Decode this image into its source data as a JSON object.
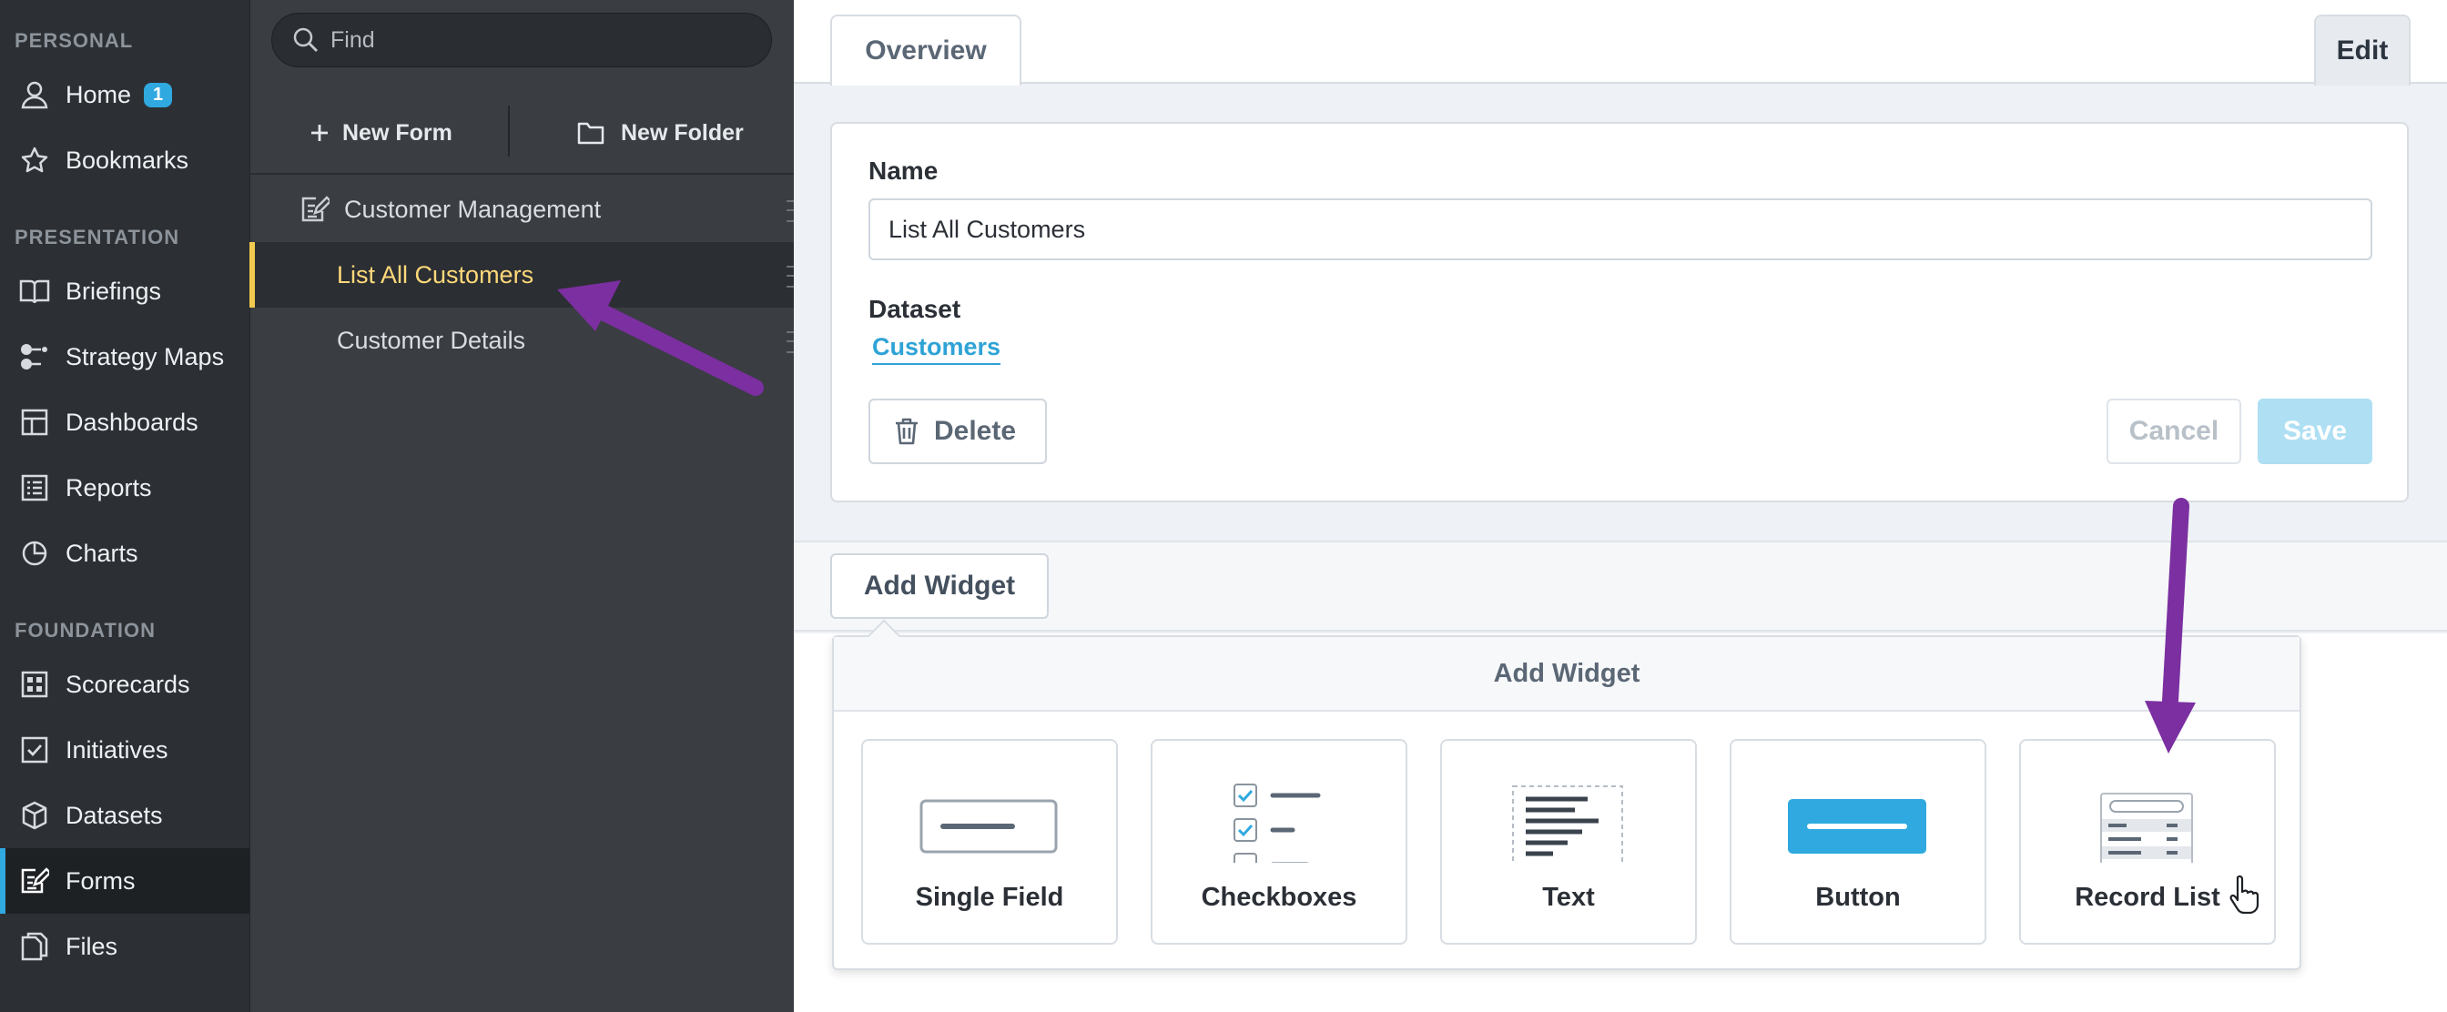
{
  "nav": {
    "sections": [
      "PERSONAL",
      "PRESENTATION",
      "FOUNDATION"
    ],
    "items": [
      {
        "label": "Home",
        "icon": "user-icon",
        "badge": "1"
      },
      {
        "label": "Bookmarks",
        "icon": "star-icon"
      },
      {
        "label": "Briefings",
        "icon": "book-icon"
      },
      {
        "label": "Strategy Maps",
        "icon": "strategy-map-icon"
      },
      {
        "label": "Dashboards",
        "icon": "dashboard-icon"
      },
      {
        "label": "Reports",
        "icon": "report-icon"
      },
      {
        "label": "Charts",
        "icon": "pie-chart-icon"
      },
      {
        "label": "Scorecards",
        "icon": "scorecard-icon"
      },
      {
        "label": "Initiatives",
        "icon": "checkbox-icon"
      },
      {
        "label": "Datasets",
        "icon": "cube-icon"
      },
      {
        "label": "Forms",
        "icon": "form-icon",
        "active": true
      },
      {
        "label": "Files",
        "icon": "files-icon"
      }
    ]
  },
  "tree": {
    "search_placeholder": "Find",
    "new_form_label": "New Form",
    "new_folder_label": "New Folder",
    "folder_label": "Customer Management",
    "items": [
      "List All Customers",
      "Customer Details"
    ],
    "selected": "List All Customers"
  },
  "tabs": {
    "overview": "Overview",
    "edit": "Edit"
  },
  "form": {
    "name_label": "Name",
    "name_value": "List All Customers",
    "dataset_label": "Dataset",
    "dataset_value": "Customers",
    "delete_label": "Delete",
    "cancel_label": "Cancel",
    "save_label": "Save"
  },
  "add_widget": {
    "button_label": "Add Widget",
    "popover_title": "Add Widget",
    "widgets": [
      "Single Field",
      "Checkboxes",
      "Text",
      "Button",
      "Record List"
    ]
  },
  "colors": {
    "accent": "#2fa9e0",
    "selected_text": "#ffd97a",
    "annotation_arrow": "#7b2fa0"
  }
}
